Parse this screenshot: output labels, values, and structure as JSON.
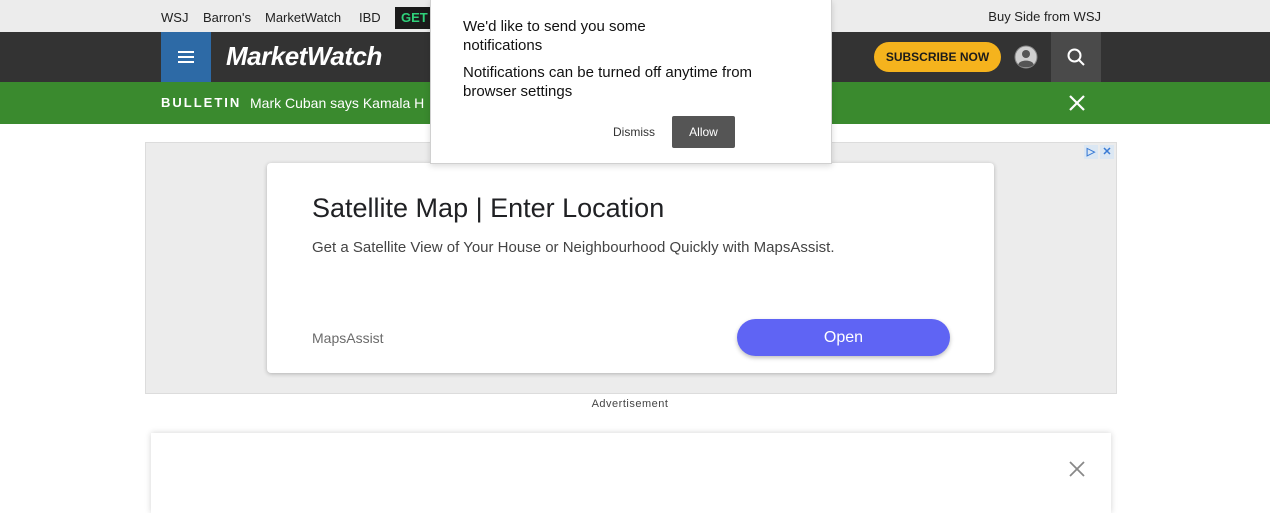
{
  "partner_bar": {
    "links": [
      "WSJ",
      "Barron's",
      "MarketWatch",
      "IBD"
    ],
    "get_label": "GET",
    "buy_side": "Buy Side from WSJ"
  },
  "header": {
    "logo": "MarketWatch",
    "subscribe_label": "SUBSCRIBE NOW",
    "icons": [
      "menu-icon",
      "user-icon",
      "search-icon"
    ],
    "colors": {
      "header_bg": "#333333",
      "menu_bg": "#2d6aa6",
      "subscribe_bg": "#f5b31d"
    }
  },
  "bulletin": {
    "tag": "BULLETIN",
    "text": "Mark Cuban says Kamala H",
    "color": "#3a8a2e"
  },
  "ad": {
    "title": "Satellite Map | Enter Location",
    "description": "Get a Satellite View of Your House or Neighbourhood Quickly with MapsAssist.",
    "brand": "MapsAssist",
    "cta": "Open",
    "label": "Advertisement",
    "adchoices": [
      "▷",
      "✕"
    ],
    "cta_color": "#5f64f4"
  },
  "notification": {
    "question": "We'd like to send you some notifications",
    "subtext": "Notifications can be turned off anytime from browser settings",
    "dismiss": "Dismiss",
    "allow": "Allow"
  }
}
